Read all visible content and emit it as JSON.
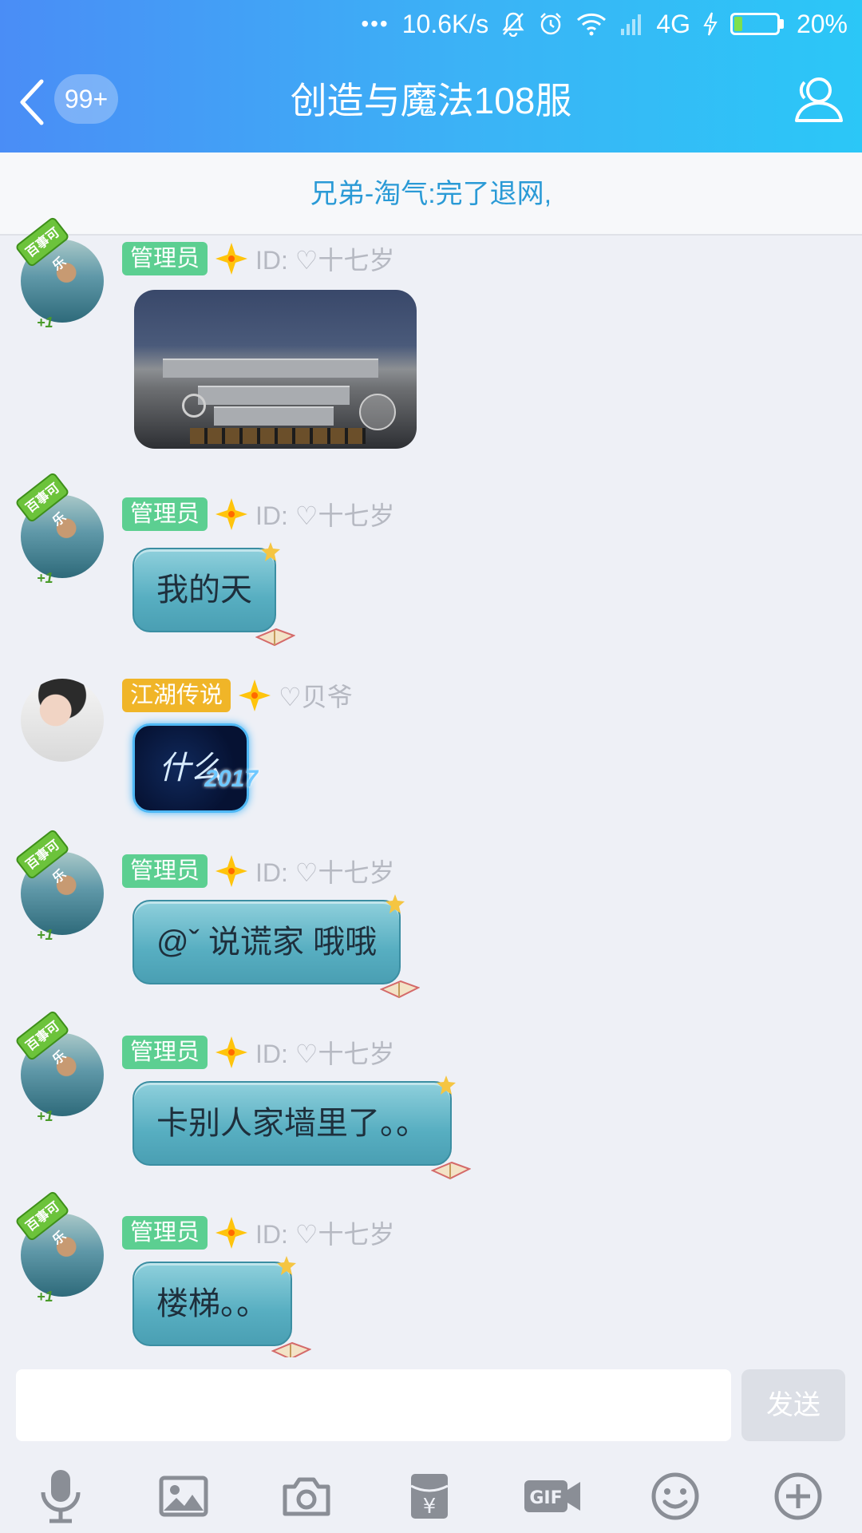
{
  "status_bar": {
    "dots": "•••",
    "net_speed": "10.6K/s",
    "network": "4G",
    "battery": "20%",
    "battery_level": 0.2
  },
  "header": {
    "unread": "99+",
    "title": "创造与魔法108服"
  },
  "notice": {
    "text": "兄弟-淘气:完了退网,"
  },
  "messages": [
    {
      "badge": "管理员",
      "nick": "ID: ♡十七岁",
      "type": "image",
      "image_alt": "game screenshot"
    },
    {
      "badge": "管理员",
      "nick": "ID: ♡十七岁",
      "text": "我的天"
    },
    {
      "badge": "江湖传说",
      "nick": "♡贝爷",
      "text": "什么",
      "year": "2017"
    },
    {
      "badge": "管理员",
      "nick": "ID: ♡十七岁",
      "text": "@ˇ 说谎家 哦哦"
    },
    {
      "badge": "管理员",
      "nick": "ID: ♡十七岁",
      "text": "卡别人家墙里了。。"
    },
    {
      "badge": "管理员",
      "nick": "ID: ♡十七岁",
      "text": "楼梯。。"
    }
  ],
  "avatar_pendant": "百事可乐",
  "avatar_plus": "+1",
  "composer": {
    "value": "",
    "send_label": "发送"
  },
  "toolbar": {
    "icons": [
      "microphone-icon",
      "image-icon",
      "camera-icon",
      "red-packet-icon",
      "gif-icon",
      "emoji-icon",
      "plus-circle-icon"
    ],
    "gif_label": "GIF",
    "packet_symbol": "¥"
  },
  "colors": {
    "header_gradient": [
      "#4a8df6",
      "#2bc7f7"
    ],
    "admin_badge": "#5ccf91",
    "legend_badge": "#f0b528",
    "notice_text": "#2a9ad6",
    "bubble": "#57aec1"
  }
}
